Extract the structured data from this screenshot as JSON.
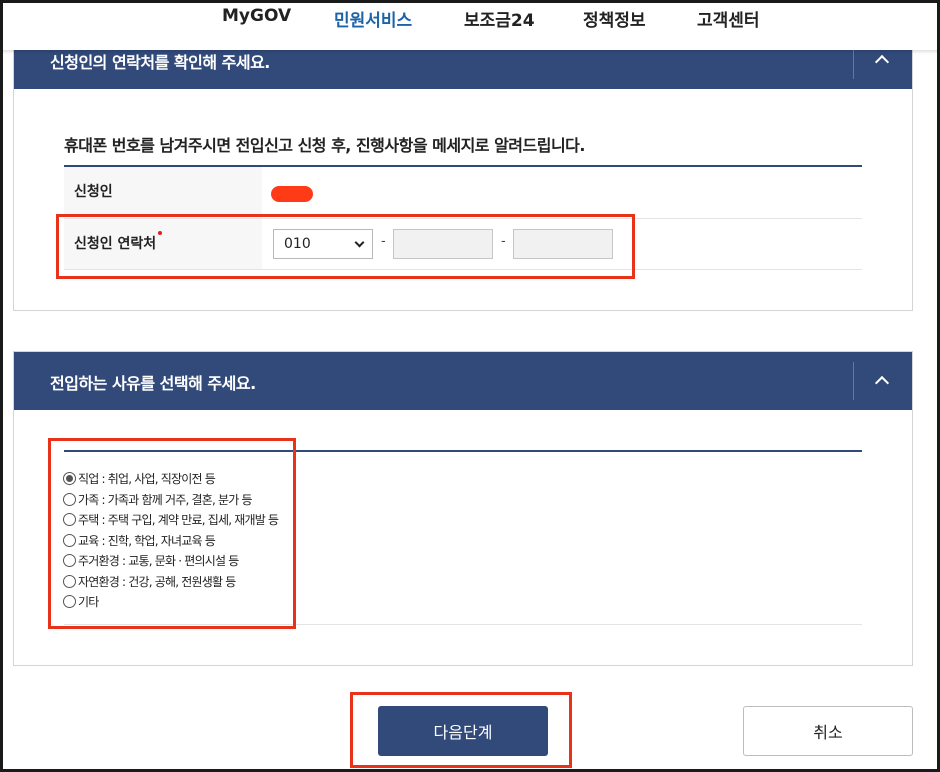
{
  "nav": {
    "items": [
      {
        "label": "MyGOV"
      },
      {
        "label": "민원서비스"
      },
      {
        "label": "보조금24"
      },
      {
        "label": "정책정보"
      },
      {
        "label": "고객센터"
      }
    ],
    "active_index": 1
  },
  "contact_section": {
    "title": "신청인의 연락처를 확인해 주세요.",
    "intro": "휴대폰 번호를 남겨주시면 전입신고 신청 후, 진행사항을 메세지로 알려드립니다.",
    "applicant_label": "신청인",
    "phone_label": "신청인 연락처",
    "phone_prefix": "010",
    "phone_middle": "",
    "phone_last": "",
    "separator": "-"
  },
  "reason_section": {
    "title": "전입하는 사유를 선택해 주세요.",
    "options": [
      {
        "label": "직업 : 취업, 사업, 직장이전 등",
        "checked": true
      },
      {
        "label": "가족 : 가족과 함께 거주, 결혼, 분가 등",
        "checked": false
      },
      {
        "label": "주택 : 주택 구입, 계약 만료, 집세, 재개발 등",
        "checked": false
      },
      {
        "label": "교육 : 진학, 학업, 자녀교육 등",
        "checked": false
      },
      {
        "label": "주거환경 : 교통, 문화 · 편의시설 등",
        "checked": false
      },
      {
        "label": "자연환경 : 건강, 공해, 전원생활 등",
        "checked": false
      },
      {
        "label": "기타",
        "checked": false
      }
    ]
  },
  "buttons": {
    "next": "다음단계",
    "cancel": "취소"
  },
  "colors": {
    "header_navy": "#324a7a",
    "nav_active": "#1d63a8",
    "annotation_red": "#e8321a",
    "required_dot": "#e0201b"
  },
  "icons": {
    "section_toggle": "chevron-up-icon",
    "select_arrow": "chevron-down-icon"
  }
}
